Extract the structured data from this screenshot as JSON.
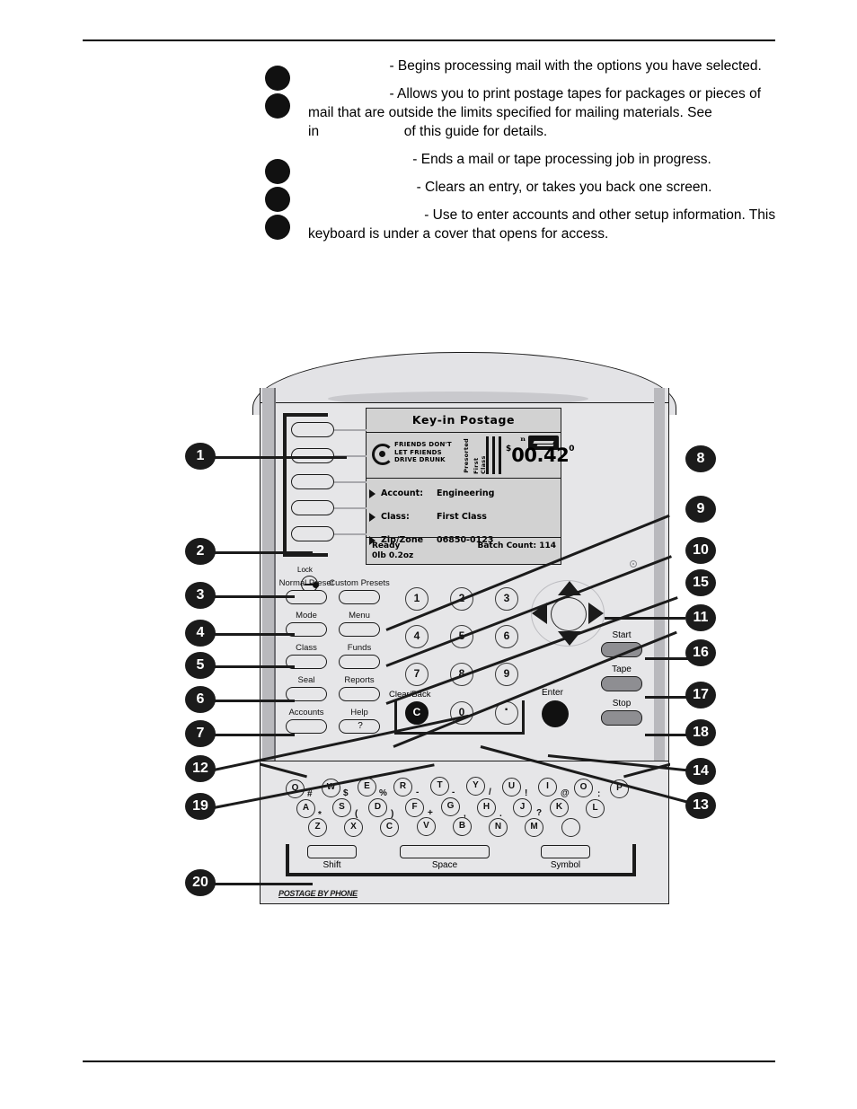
{
  "document": {
    "bullets": [
      {
        "id": "start-key",
        "term": "",
        "text": "                     - Begins processing mail with the options you have selected."
      },
      {
        "id": "tape-key",
        "term": "",
        "text": "                     - Allows you to print postage tapes for packages or pieces of mail that are outside the limits specified for mailing materials. See                      in                      of this guide for details."
      },
      {
        "id": "stop-key",
        "term": "",
        "text": "                           - Ends a mail or tape processing job in progress."
      },
      {
        "id": "clear-back-key",
        "term": "",
        "text": "                            - Clears an entry, or takes you back one screen."
      },
      {
        "id": "keyboard",
        "term": "",
        "text": "                              - Use to enter accounts and other setup information. This keyboard is under a cover that opens for access."
      }
    ]
  },
  "device": {
    "brand_logo": "POSTAGE BY PHONE",
    "lcd": {
      "title": "Key-in Postage",
      "stamp": {
        "ad_lines": [
          "FRIENDS DON'T",
          "LET FRIENDS",
          "DRIVE DRUNK"
        ],
        "class_line_1": "Presorted",
        "class_line_2": "First Class",
        "currency": "$",
        "dollars": "00",
        "cents": ".42",
        "superscript": "0"
      },
      "fields": [
        {
          "label": "Account:",
          "value": "Engineering"
        },
        {
          "label": "Class:",
          "value": "First Class"
        },
        {
          "label": "Zip/Zone",
          "value": "06850-0123"
        }
      ],
      "status": {
        "state": "Ready",
        "weight": "0lb 0.2oz",
        "batch": "Batch Count: 114"
      }
    },
    "lock_label": "Lock",
    "function_keys_left": [
      "Normal Preset",
      "Mode",
      "Class",
      "Seal",
      "Accounts"
    ],
    "function_keys_right": [
      "Custom Presets",
      "Menu",
      "Funds",
      "Reports",
      "Help"
    ],
    "help_glyph": "?",
    "numeric_keys": [
      "1",
      "2",
      "3",
      "4",
      "5",
      "6",
      "7",
      "8",
      "9"
    ],
    "clear_back_label": "Clear/Back",
    "clear_key": "C",
    "zero_key": "0",
    "decimal_key": "·",
    "enter_label": "Enter",
    "action_buttons": [
      "Start",
      "Tape",
      "Stop"
    ],
    "keyboard": {
      "row1": [
        "Q",
        "W",
        "E",
        "R",
        "T",
        "Y",
        "U",
        "I",
        "O",
        "P"
      ],
      "row2": [
        "A",
        "S",
        "D",
        "F",
        "G",
        "H",
        "J",
        "K",
        "L"
      ],
      "row3": [
        "Z",
        "X",
        "C",
        "V",
        "B",
        "N",
        "M",
        ""
      ],
      "symbols_row1": [
        "#",
        "$",
        "%",
        "-",
        "-",
        "/",
        "!",
        "@",
        ":"
      ],
      "symbols_row2": [
        "*",
        "(",
        ")",
        "+",
        ",",
        ".",
        "?"
      ],
      "modifier_keys": [
        "Shift",
        "Space",
        "Symbol"
      ]
    }
  },
  "callouts": {
    "left": [
      "1",
      "2",
      "3",
      "4",
      "5",
      "6",
      "7",
      "12",
      "19",
      "20"
    ],
    "right": [
      "8",
      "9",
      "10",
      "15",
      "11",
      "16",
      "17",
      "18",
      "14",
      "13"
    ]
  },
  "colors": {
    "body": "#e6e6e8",
    "lcd": "#d2d2d2",
    "action_button": "#8e8e92",
    "ink": "#1b1b1b"
  }
}
